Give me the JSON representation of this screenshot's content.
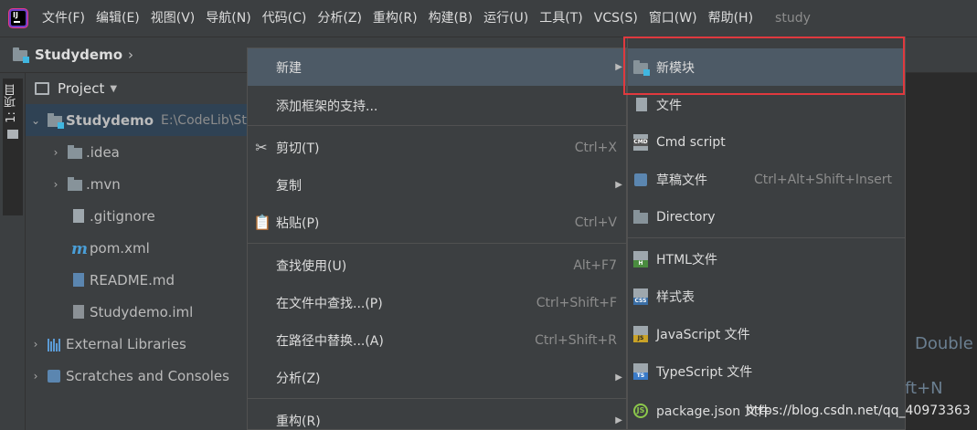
{
  "menubar": {
    "items": [
      "文件(F)",
      "编辑(E)",
      "视图(V)",
      "导航(N)",
      "代码(C)",
      "分析(Z)",
      "重构(R)",
      "构建(B)",
      "运行(U)",
      "工具(T)",
      "VCS(S)",
      "窗口(W)",
      "帮助(H)"
    ],
    "project": "study"
  },
  "breadcrumb": {
    "label": "Studydemo",
    "chevron": "›"
  },
  "tool_strip": {
    "project_tab": "1: 项目"
  },
  "project_panel": {
    "title": "Project",
    "tree": [
      {
        "label": "Studydemo",
        "path": "E:\\CodeLib\\St",
        "icon": "module-folder-icon",
        "selected": true
      },
      {
        "label": ".idea",
        "icon": "folder-icon"
      },
      {
        "label": ".mvn",
        "icon": "folder-icon"
      },
      {
        "label": ".gitignore",
        "icon": "gitignore-file-icon"
      },
      {
        "label": "pom.xml",
        "icon": "maven-icon"
      },
      {
        "label": "README.md",
        "icon": "markdown-file-icon"
      },
      {
        "label": "Studydemo.iml",
        "icon": "iml-file-icon"
      },
      {
        "label": "External Libraries",
        "icon": "libraries-icon"
      },
      {
        "label": "Scratches and Consoles",
        "icon": "scratches-icon"
      }
    ]
  },
  "context_menu": {
    "items": [
      {
        "label": "新建",
        "shortcut": "",
        "submenu": true,
        "icon": ""
      },
      {
        "label": "添加框架的支持...",
        "shortcut": "",
        "submenu": false,
        "icon": ""
      },
      {
        "label": "剪切(T)",
        "shortcut": "Ctrl+X",
        "submenu": false,
        "icon": "scissors-icon"
      },
      {
        "label": "复制",
        "shortcut": "",
        "submenu": true,
        "icon": ""
      },
      {
        "label": "粘贴(P)",
        "shortcut": "Ctrl+V",
        "submenu": false,
        "icon": "clipboard-icon"
      },
      {
        "label": "查找使用(U)",
        "shortcut": "Alt+F7",
        "submenu": false,
        "icon": ""
      },
      {
        "label": "在文件中查找...(P)",
        "shortcut": "Ctrl+Shift+F",
        "submenu": false,
        "icon": ""
      },
      {
        "label": "在路径中替换...(A)",
        "shortcut": "Ctrl+Shift+R",
        "submenu": false,
        "icon": ""
      },
      {
        "label": "分析(Z)",
        "shortcut": "",
        "submenu": true,
        "icon": ""
      },
      {
        "label": "重构(R)",
        "shortcut": "",
        "submenu": true,
        "icon": ""
      }
    ]
  },
  "submenu": {
    "items": [
      {
        "label": "新模块",
        "shortcut": ""
      },
      {
        "label": "文件",
        "shortcut": ""
      },
      {
        "label": "Cmd script",
        "shortcut": ""
      },
      {
        "label": "草稿文件",
        "shortcut": "Ctrl+Alt+Shift+Insert"
      },
      {
        "label": "Directory",
        "shortcut": ""
      },
      {
        "label": "HTML文件",
        "shortcut": ""
      },
      {
        "label": "样式表",
        "shortcut": ""
      },
      {
        "label": "JavaScript 文件",
        "shortcut": ""
      },
      {
        "label": "TypeScript 文件",
        "shortcut": ""
      },
      {
        "label": "package.json 文件",
        "shortcut": ""
      }
    ],
    "badges": {
      "cmd": "CMD",
      "html": "H",
      "css": "CSS",
      "js": "JS",
      "ts": "TS",
      "npm": "JS"
    }
  },
  "editor": {
    "hint_1": "Double",
    "hint_2": "ft+N"
  },
  "watermark": "https://blog.csdn.net/qq_40973363",
  "colors": {
    "highlight": "#e0393e",
    "menu_bg": "#3c3f41",
    "active_bg": "#4d5a66",
    "module_accent": "#40b6e0"
  }
}
